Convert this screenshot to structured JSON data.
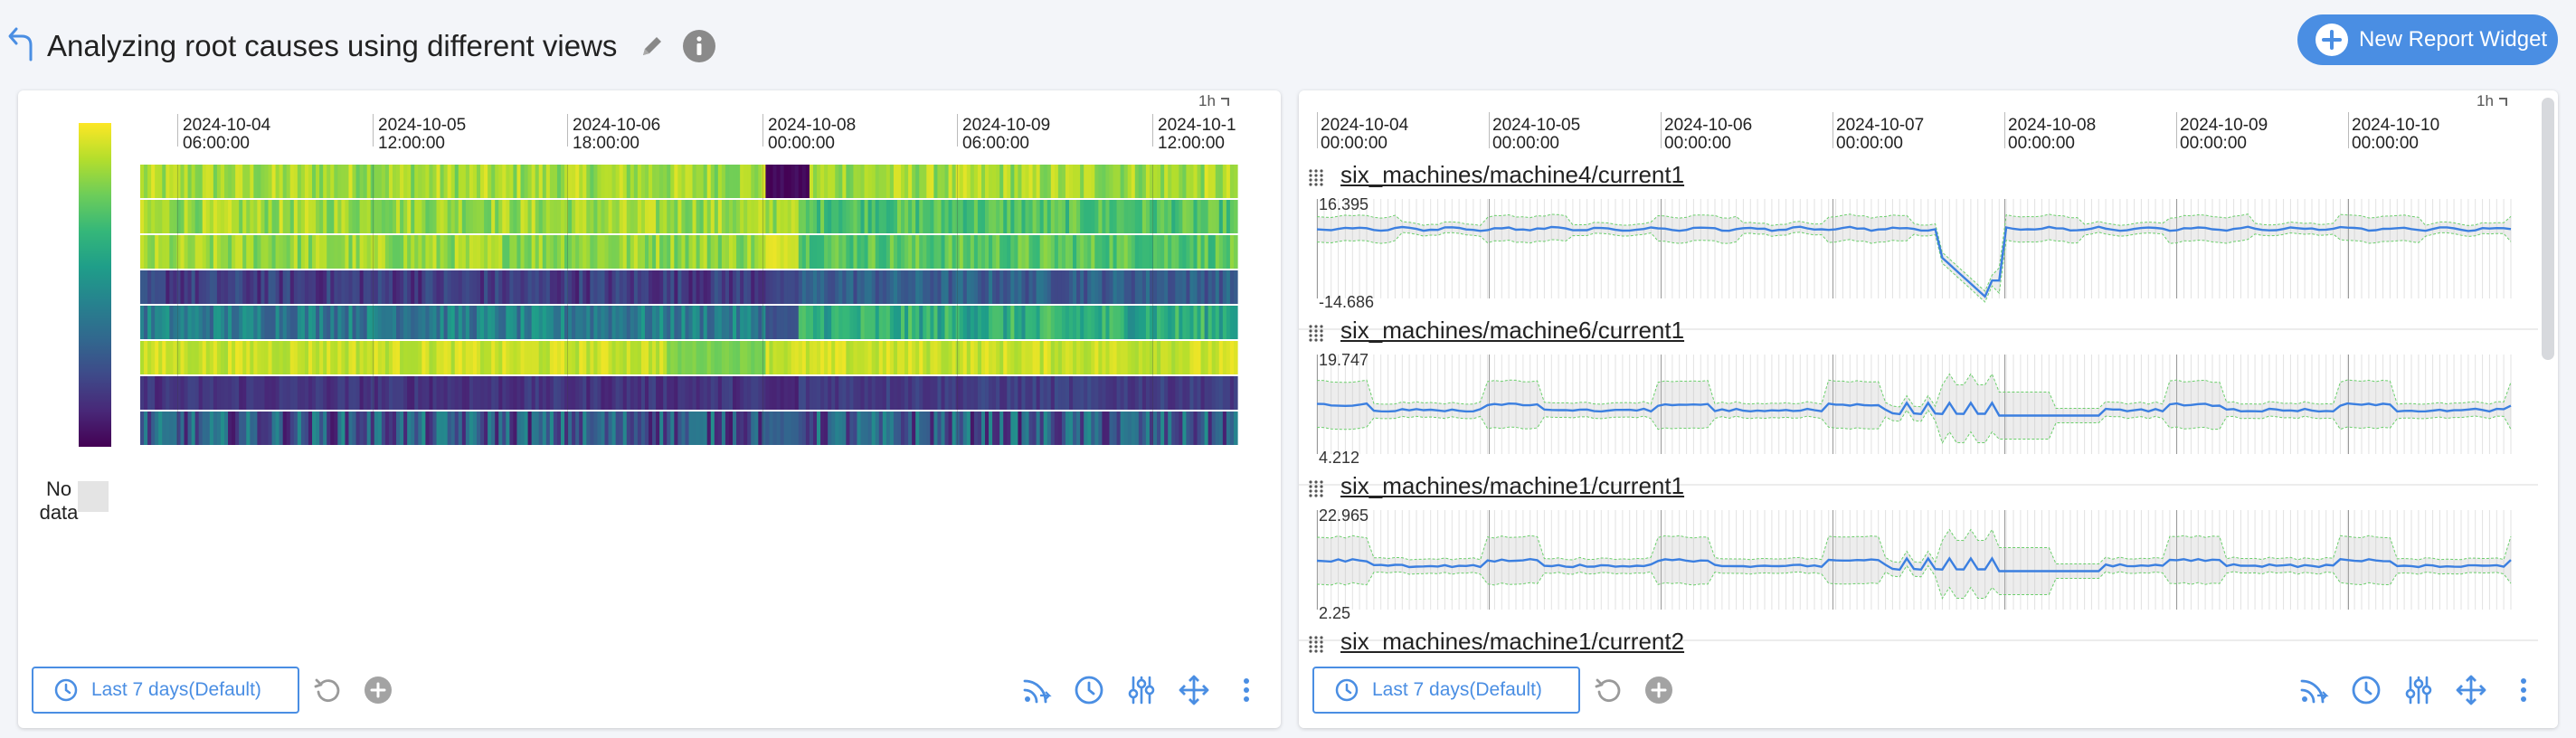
{
  "header": {
    "title": "Analyzing root causes using different views",
    "new_widget_label": "New Report Widget",
    "back_icon": "back-arrow-icon",
    "edit_icon": "pencil-icon",
    "info_icon": "info-icon"
  },
  "colors": {
    "accent": "#4a8ee3",
    "series_line": "#3b7fe0",
    "envelope": "#6ccf6c",
    "viridis_low": "#440154",
    "viridis_high": "#fde725"
  },
  "heatmap_widget": {
    "resolution": "1h",
    "nodata_label": "No data",
    "time_ticks": [
      {
        "date": "2024-10-04",
        "time": "06:00:00"
      },
      {
        "date": "2024-10-05",
        "time": "12:00:00"
      },
      {
        "date": "2024-10-06",
        "time": "18:00:00"
      },
      {
        "date": "2024-10-08",
        "time": "00:00:00"
      },
      {
        "date": "2024-10-09",
        "time": "06:00:00"
      },
      {
        "date": "2024-10-1",
        "time": "12:00:00"
      }
    ],
    "rows": [
      {
        "base": 0.86,
        "var": 0.1,
        "dip_start": 0.57,
        "dip_end": 0.61,
        "dip_value": 0.02,
        "shift_after": 0.86
      },
      {
        "base": 0.85,
        "var": 0.1,
        "dip_start": 0.58,
        "dip_end": 0.6,
        "dip_value": 0.9,
        "shift_after": 0.72
      },
      {
        "base": 0.84,
        "var": 0.1,
        "dip_start": 0.57,
        "dip_end": 0.6,
        "dip_value": 0.95,
        "shift_after": 0.74
      },
      {
        "base": 0.18,
        "var": 0.1,
        "dip_start": 0.57,
        "dip_end": 0.6,
        "dip_value": 0.2,
        "shift_after": 0.3
      },
      {
        "base": 0.42,
        "var": 0.14,
        "dip_start": 0.57,
        "dip_end": 0.6,
        "dip_value": 0.25,
        "shift_after": 0.62
      },
      {
        "base": 0.92,
        "var": 0.06,
        "dip_start": 0.48,
        "dip_end": 0.57,
        "dip_value": 0.8,
        "shift_after": 0.92
      },
      {
        "base": 0.15,
        "var": 0.06,
        "dip_start": 0.57,
        "dip_end": 0.6,
        "dip_value": 0.1,
        "shift_after": 0.18
      },
      {
        "base": 0.28,
        "var": 0.22,
        "dip_start": 0.57,
        "dip_end": 0.6,
        "dip_value": 0.3,
        "shift_after": 0.28
      }
    ],
    "footer": {
      "time_range_label": "Last 7 days(Default)",
      "icons": [
        "reset-icon",
        "add-icon",
        "live-feed-icon",
        "clock-icon",
        "sliders-icon",
        "move-icon",
        "more-icon"
      ]
    }
  },
  "line_widget": {
    "resolution": "1h",
    "time_ticks": [
      {
        "date": "2024-10-04",
        "time": "00:00:00"
      },
      {
        "date": "2024-10-05",
        "time": "00:00:00"
      },
      {
        "date": "2024-10-06",
        "time": "00:00:00"
      },
      {
        "date": "2024-10-07",
        "time": "00:00:00"
      },
      {
        "date": "2024-10-08",
        "time": "00:00:00"
      },
      {
        "date": "2024-10-09",
        "time": "00:00:00"
      },
      {
        "date": "2024-10-10",
        "time": "00:00:00"
      }
    ],
    "charts": [
      {
        "title": "six_machines/machine4/current1",
        "ymax": "16.395",
        "ymin": "-14.686",
        "pattern": "drop"
      },
      {
        "title": "six_machines/machine6/current1",
        "ymax": "19.747",
        "ymin": "4.212",
        "pattern": "wiggle"
      },
      {
        "title": "six_machines/machine1/current1",
        "ymax": "22.965",
        "ymin": "2.25",
        "pattern": "wiggle"
      },
      {
        "title": "six_machines/machine1/current2",
        "ymax": "",
        "ymin": "",
        "pattern": "none"
      }
    ],
    "footer": {
      "time_range_label": "Last 7 days(Default)",
      "icons": [
        "reset-icon",
        "add-icon",
        "live-feed-icon",
        "clock-icon",
        "sliders-icon",
        "move-icon",
        "more-icon"
      ]
    }
  }
}
